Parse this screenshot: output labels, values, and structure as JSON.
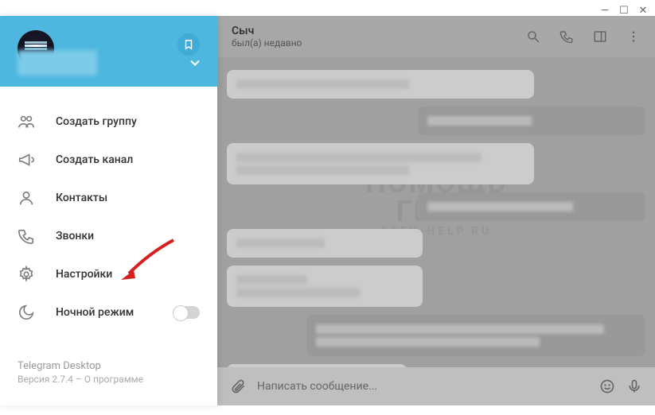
{
  "window_controls": {
    "min": "—",
    "max": "☐",
    "close": "✕"
  },
  "menu": {
    "create_group": "Создать группу",
    "create_channel": "Создать канал",
    "contacts": "Контакты",
    "calls": "Звонки",
    "settings": "Настройки",
    "night_mode": "Ночной режим"
  },
  "footer": {
    "app_name": "Telegram Desktop",
    "version_line": "Версия 2.7.4 – О программе"
  },
  "chat": {
    "title": "Сыч",
    "status": "был(а) недавно",
    "composer_placeholder": "Написать сообщение..."
  },
  "watermark": {
    "line1": "ПОМОЩЬ",
    "line2": "ГИКА",
    "sub": "GEEK-HELP.RU"
  }
}
